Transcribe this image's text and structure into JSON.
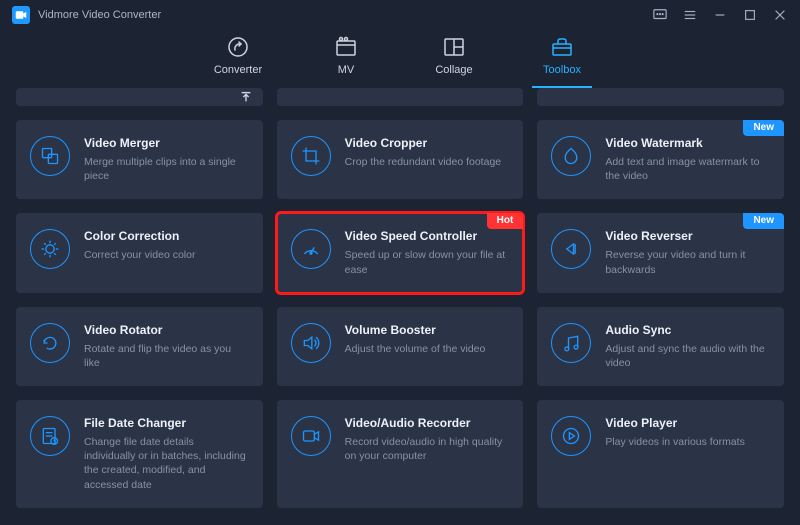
{
  "app": {
    "title": "Vidmore Video Converter"
  },
  "tabs": [
    {
      "label": "Converter"
    },
    {
      "label": "MV"
    },
    {
      "label": "Collage"
    },
    {
      "label": "Toolbox"
    }
  ],
  "cards": {
    "merger": {
      "title": "Video Merger",
      "desc": "Merge multiple clips into a single piece"
    },
    "cropper": {
      "title": "Video Cropper",
      "desc": "Crop the redundant video footage"
    },
    "watermark": {
      "title": "Video Watermark",
      "desc": "Add text and image watermark to the video",
      "badge": "New"
    },
    "color": {
      "title": "Color Correction",
      "desc": "Correct your video color"
    },
    "speed": {
      "title": "Video Speed Controller",
      "desc": "Speed up or slow down your file at ease",
      "badge": "Hot"
    },
    "reverser": {
      "title": "Video Reverser",
      "desc": "Reverse your video and turn it backwards",
      "badge": "New"
    },
    "rotator": {
      "title": "Video Rotator",
      "desc": "Rotate and flip the video as you like"
    },
    "volume": {
      "title": "Volume Booster",
      "desc": "Adjust the volume of the video"
    },
    "sync": {
      "title": "Audio Sync",
      "desc": "Adjust and sync the audio with the video"
    },
    "filedate": {
      "title": "File Date Changer",
      "desc": "Change file date details individually or in batches, including the created, modified, and accessed date"
    },
    "recorder": {
      "title": "Video/Audio Recorder",
      "desc": "Record video/audio in high quality on your computer"
    },
    "player": {
      "title": "Video Player",
      "desc": "Play videos in various formats"
    }
  }
}
